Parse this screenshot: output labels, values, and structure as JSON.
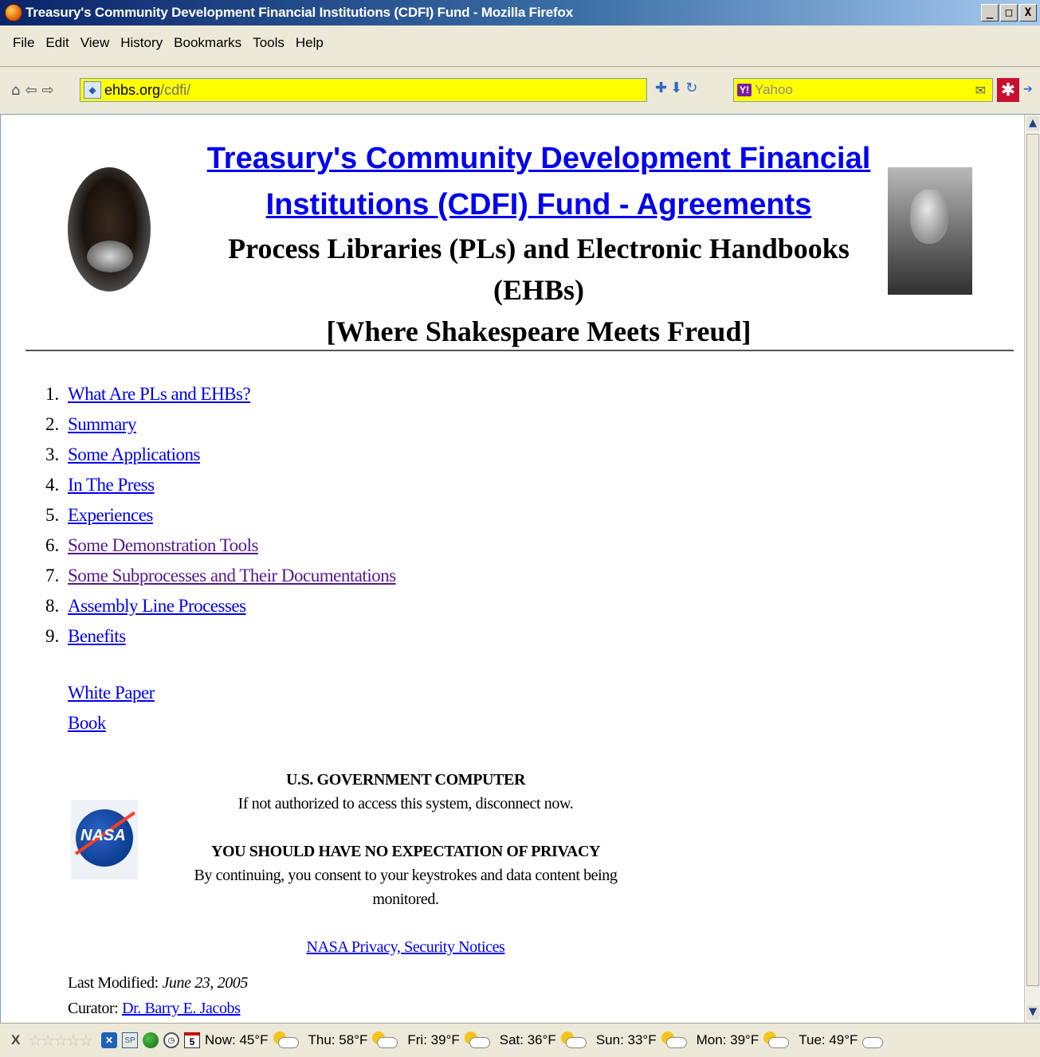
{
  "window": {
    "title": "Treasury's Community Development Financial Institutions (CDFI) Fund - Mozilla Firefox",
    "buttons": [
      "_",
      "□",
      "X"
    ]
  },
  "menubar": {
    "items": [
      "File",
      "Edit",
      "View",
      "History",
      "Bookmarks",
      "Tools",
      "Help"
    ]
  },
  "navbar": {
    "url_domain": "ehbs.org",
    "url_path": "/cdfi/",
    "search_placeholder": "Yahoo",
    "search_engine_label": "Y!"
  },
  "page": {
    "title_line1": "Treasury's Community Development Financial",
    "title_line2": "Institutions (CDFI) Fund - Agreements",
    "subtitle_line1": "Process Libraries (PLs) and Electronic Handbooks (EHBs)",
    "subtitle_line2": "[Where Shakespeare Meets Freud]",
    "toc": [
      {
        "num": "1.",
        "label": "What Are PLs and EHBs?",
        "visited": false
      },
      {
        "num": "2.",
        "label": "Summary",
        "visited": false
      },
      {
        "num": "3.",
        "label": "Some Applications",
        "visited": false
      },
      {
        "num": "4.",
        "label": "In The Press",
        "visited": false
      },
      {
        "num": "5.",
        "label": "Experiences",
        "visited": false
      },
      {
        "num": "6.",
        "label": "Some Demonstration Tools",
        "visited": true
      },
      {
        "num": "7.",
        "label": "Some Subprocesses and Their Documentations",
        "visited": true
      },
      {
        "num": "8.",
        "label": "Assembly Line Processes",
        "visited": false
      },
      {
        "num": "9.",
        "label": "Benefits",
        "visited": false
      }
    ],
    "extra_links": [
      "White Paper",
      "Book"
    ],
    "notice": {
      "heading1": "U.S. GOVERNMENT COMPUTER",
      "line1": "If not authorized to access this system, disconnect now.",
      "heading2": "YOU SHOULD HAVE NO EXPECTATION OF PRIVACY",
      "line2": "By continuing, you consent to your keystrokes and data content being monitored.",
      "link": "NASA Privacy, Security Notices"
    },
    "nasa_logo_text": "NASA",
    "last_modified_label": "Last Modified:",
    "last_modified_date": "June 23, 2005",
    "curator_label": "Curator:",
    "curator_name": "Dr. Barry E. Jacobs"
  },
  "statusbar": {
    "close_label": "X",
    "stars": "☆☆☆☆☆",
    "calendar_day": "5",
    "sp_label": "SP",
    "weather": [
      {
        "label": "Now: 45°F",
        "icon": "partly-cloudy-icon"
      },
      {
        "label": "Thu: 58°F",
        "icon": "partly-cloudy-icon"
      },
      {
        "label": "Fri: 39°F",
        "icon": "partly-cloudy-icon"
      },
      {
        "label": "Sat: 36°F",
        "icon": "partly-cloudy-icon"
      },
      {
        "label": "Sun: 33°F",
        "icon": "partly-cloudy-icon"
      },
      {
        "label": "Mon: 39°F",
        "icon": "partly-cloudy-icon"
      },
      {
        "label": "Tue: 49°F",
        "icon": "cloudy-icon"
      }
    ]
  }
}
